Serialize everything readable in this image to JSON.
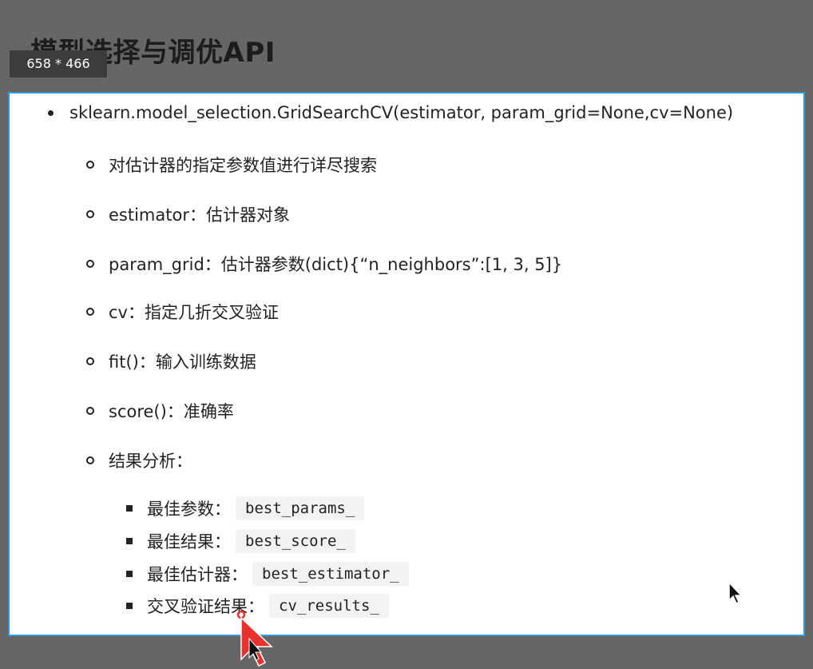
{
  "slide": {
    "title": "模型选择与调优API"
  },
  "overlay": {
    "size_badge": "658 * 466"
  },
  "content": {
    "main_bullet": "sklearn.model_selection.GridSearchCV(estimator, param_grid=None,cv=None)",
    "sub_bullets": [
      "对估计器的指定参数值进行详尽搜索",
      "estimator：估计器对象",
      "param_grid：估计器参数(dict){“n_neighbors”:[1, 3, 5]}",
      "cv：指定几折交叉验证",
      "fit()：输入训练数据",
      "score()：准确率",
      "结果分析："
    ],
    "results": [
      {
        "label": "最佳参数：",
        "code": "best_params_"
      },
      {
        "label": "最佳结果：",
        "code": "best_score_"
      },
      {
        "label": "最佳估计器：",
        "code": "best_estimator_"
      },
      {
        "label": "交叉验证结果：",
        "code": "cv_results_"
      }
    ]
  },
  "colors": {
    "selection_border": "#2e9ad6",
    "cursor_red": "#e8332c",
    "backdrop": "#666666"
  },
  "icons": {
    "pointer_red": "cursor-arrow-icon",
    "pointer_black": "mouse-pointer-icon"
  }
}
